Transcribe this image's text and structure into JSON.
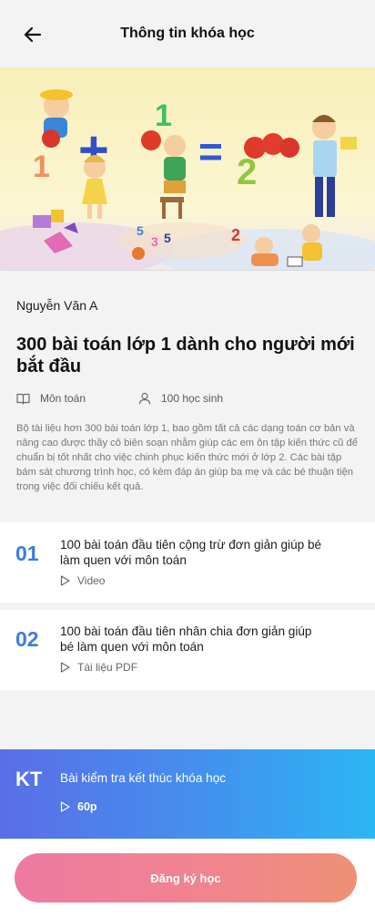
{
  "header": {
    "title": "Thông tin khóa học"
  },
  "course": {
    "author": "Nguyễn Văn A",
    "title": "300 bài toán lớp 1 dành cho người mới bắt đầu",
    "subject": "Môn toán",
    "students": "100 học sinh",
    "description": "Bộ tài liệu hơn 300 bài toán lớp 1, bao gồm tất cả các dạng toán cơ bản và nâng cao được thầy cô biên soạn nhằm giúp các em ôn tập kiến thức cũ để chuẩn bị tốt nhất cho việc chinh phục kiến thức mới ở lớp 2. Các bài tập bám sát chương trình học, có kèm đáp án giúp ba mẹ và các bé thuận tiện trong việc đối chiếu kết quả."
  },
  "lessons": [
    {
      "number": "01",
      "title": "100 bài toán đầu tiên cộng trừ đơn giản giúp bé làm quen với môn toán",
      "type": "Video"
    },
    {
      "number": "02",
      "title": "100 bài toán đầu tiên nhân chia đơn giản giúp bé làm quen với môn toán",
      "type": "Tài liệu PDF"
    }
  ],
  "exam": {
    "code": "KT",
    "title": "Bài kiểm tra kết thúc khóa học",
    "duration": "60p"
  },
  "actions": {
    "register_label": "Đăng ký học"
  },
  "banner": {
    "equation_1": "1",
    "plus": "+",
    "equation_2": "1",
    "equals": "=",
    "result": "2"
  },
  "colors": {
    "accent_blue": "#3e7be0",
    "exam_gradient_start": "#5a6ee6",
    "exam_gradient_end": "#2bb6f5",
    "button_gradient_start": "#ee7aa2",
    "button_gradient_end": "#ee9175"
  },
  "icons": {
    "back": "arrow-left-icon",
    "subject": "book-icon",
    "students": "user-icon",
    "play": "play-icon"
  }
}
